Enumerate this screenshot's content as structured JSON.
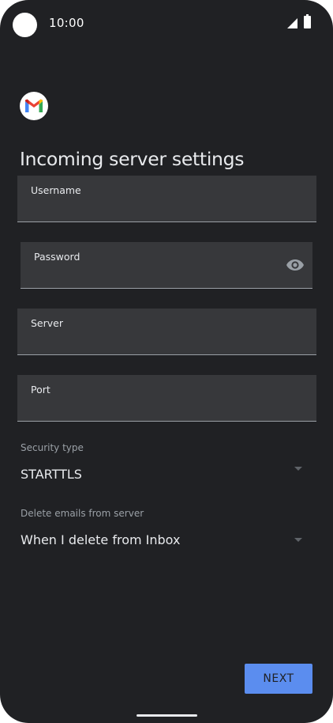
{
  "status_bar": {
    "time": "10:00",
    "signal_icon": "signal-icon",
    "battery_icon": "battery-icon"
  },
  "app": {
    "logo_icon": "gmail-logo-icon"
  },
  "page": {
    "title": "Incoming server settings"
  },
  "form": {
    "username": {
      "label": "Username",
      "value": ""
    },
    "password": {
      "label": "Password",
      "value": "",
      "toggle_icon": "eye-icon"
    },
    "server": {
      "label": "Server",
      "value": ""
    },
    "port": {
      "label": "Port",
      "value": ""
    },
    "security_type": {
      "label": "Security type",
      "value": "STARTTLS"
    },
    "delete_emails": {
      "label": "Delete emails from server",
      "value": "When I delete from Inbox"
    }
  },
  "actions": {
    "next_label": "NEXT"
  },
  "colors": {
    "background": "#202124",
    "field": "#37383b",
    "accent": "#5b8def",
    "text": "#e8eaed"
  }
}
